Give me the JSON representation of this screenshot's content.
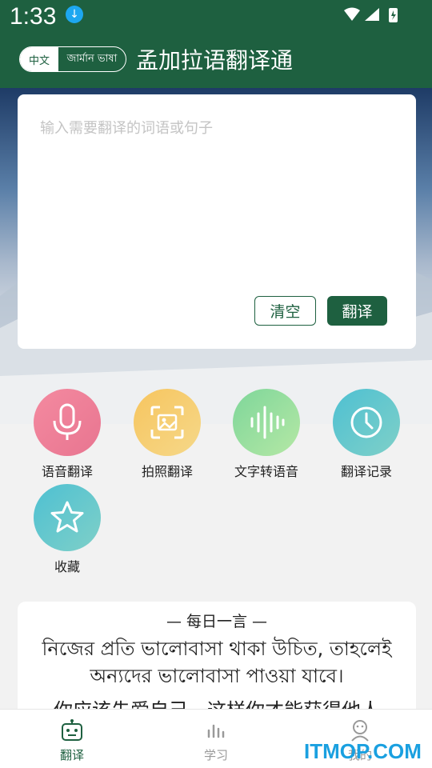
{
  "status": {
    "time": "1:33"
  },
  "header": {
    "lang_from": "中文",
    "lang_to": "জার্মান ভাষা",
    "title": "孟加拉语翻译通"
  },
  "input": {
    "placeholder": "输入需要翻译的词语或句子",
    "value": ""
  },
  "buttons": {
    "clear": "清空",
    "translate": "翻译"
  },
  "features": [
    {
      "label": "语音翻译",
      "icon": "microphone-icon",
      "color": "#ee7f96"
    },
    {
      "label": "拍照翻译",
      "icon": "photo-scan-icon",
      "color": "#f5c96a"
    },
    {
      "label": "文字转语音",
      "icon": "sound-wave-icon",
      "color": "#8fdc9e"
    },
    {
      "label": "翻译记录",
      "icon": "clock-icon",
      "color": "#5fc4d0"
    },
    {
      "label": "收藏",
      "icon": "star-icon",
      "color": "#5fc4d0"
    }
  ],
  "quote": {
    "title": "—  每日一言  —",
    "text": "নিজের প্রতি ভালোবাসা থাকা উচিত, তাহলেই অন্যদের ভালোবাসা পাওয়া যাবে।",
    "chinese": "你应该先爱自己，这样你才能获得他人"
  },
  "nav": [
    {
      "label": "翻译",
      "icon": "robot-icon",
      "active": true
    },
    {
      "label": "学习",
      "icon": "chart-bars-icon",
      "active": false
    },
    {
      "label": "我的",
      "icon": "user-icon",
      "active": false
    }
  ],
  "watermark": "ITMOP.COM",
  "colors": {
    "primary": "#1e6040",
    "accent_blue": "#1aa0e0"
  }
}
